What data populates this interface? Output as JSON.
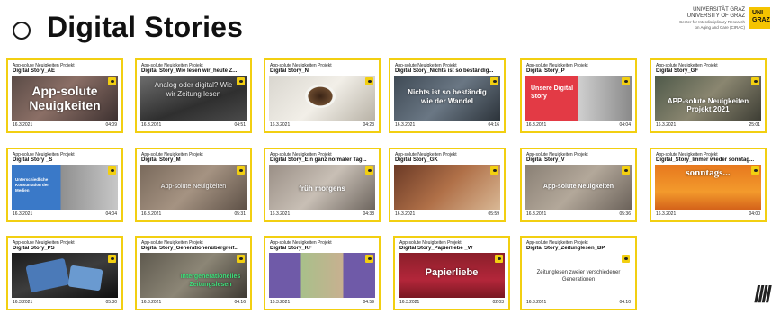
{
  "header": {
    "title": "Digital Stories",
    "logo": {
      "line1": "UNIVERSITÄT GRAZ",
      "line2": "UNIVERSITY OF GRAZ",
      "line3": "Center for Interdisciplinary Research",
      "line4": "on Aging and Care (CIRAC)",
      "mark": "UNI GRAZ"
    }
  },
  "colors": {
    "accent": "#f2cf11"
  },
  "cards": [
    {
      "project": "App-solute Neuigkeiten Projekt",
      "name": "Digital Story_AE",
      "date": "16.3.2021",
      "duration": "04:09",
      "overlay": "App-solute Neuigkeiten"
    },
    {
      "project": "App-solute Neuigkeiten Projekt",
      "name": "Digital Story_Wie lesen wir_heute Z...",
      "date": "16.3.2021",
      "duration": "04:51",
      "overlay": "Analog oder digital? Wie wir Zeitung lesen"
    },
    {
      "project": "App-solute Neuigkeiten Projekt",
      "name": "Digital Story_N",
      "date": "16.3.2021",
      "duration": "04:23",
      "overlay": ""
    },
    {
      "project": "App-solute Neuigkeiten Projekt",
      "name": "Digital Story_Nichts ist so beständig...",
      "date": "16.3.2021",
      "duration": "04:16",
      "overlay": "Nichts ist so beständig wie der Wandel"
    },
    {
      "project": "App-solute Neuigkeiten Projekt",
      "name": "Digital Story_P",
      "date": "16.3.2021",
      "duration": "04:04",
      "overlay": "Unsere Digital Story"
    },
    {
      "project": "App-solute Neuigkeiten Projekt",
      "name": "Digital Story_GF",
      "date": "16.3.2021",
      "duration": "25:01",
      "overlay": "APP-solute Neuigkeiten Projekt 2021"
    },
    {
      "project": "App-solute Neuigkeiten Projekt",
      "name": "Digital Story _S",
      "date": "16.3.2021",
      "duration": "04:04",
      "overlay": "Unterschiedliche Konsumation der Medien"
    },
    {
      "project": "App-solute Neuigkeiten Projekt",
      "name": "Digital Story_M",
      "date": "16.3.2021",
      "duration": "05:31",
      "overlay": "App-solute Neuigkeiten"
    },
    {
      "project": "App-solute Neuigkeiten Projekt",
      "name": "Digital Story_Ein ganz normaler Tag...",
      "date": "16.3.2021",
      "duration": "04:38",
      "overlay": "früh morgens"
    },
    {
      "project": "App-solute Neuigkeiten Projekt",
      "name": "Digital Story_GK",
      "date": "16.3.2021",
      "duration": "05:59",
      "overlay": ""
    },
    {
      "project": "App-solute Neuigkeiten Projekt",
      "name": "Digital Story_V",
      "date": "16.3.2021",
      "duration": "05:36",
      "overlay": "App-solute Neuigkeiten"
    },
    {
      "project": "App-solute Neuigkeiten Projekt",
      "name": "Digital_Story_Immer wieder sonntag...",
      "date": "16.3.2021",
      "duration": "04:00",
      "overlay": "sonntags..."
    },
    {
      "project": "App-solute Neuigkeiten Projekt",
      "name": "Digital Story_PS",
      "date": "16.3.2021",
      "duration": "05:30",
      "overlay": ""
    },
    {
      "project": "App-solute Neuigkeiten Projekt",
      "name": "Digital Story_Generationenübergreif...",
      "date": "16.3.2021",
      "duration": "04:16",
      "overlay": "Intergenerationelles Zeitungslesen"
    },
    {
      "project": "App-solute Neuigkeiten Projekt",
      "name": "Digital Story_KF",
      "date": "16.3.2021",
      "duration": "04:59",
      "overlay": ""
    },
    {
      "project": "App-solute Neuigkeiten Projekt",
      "name": "Digital Story_Papierliebe _W",
      "date": "16.3.2021",
      "duration": "02:03",
      "overlay": "Papierliebe"
    },
    {
      "project": "App-solute Neuigkeiten Projekt",
      "name": "Digital Story_Zeitunglesen_BP",
      "date": "16.3.2021",
      "duration": "04:10",
      "overlay": "Zeitunglesen zweier verschiedener Generationen"
    }
  ]
}
